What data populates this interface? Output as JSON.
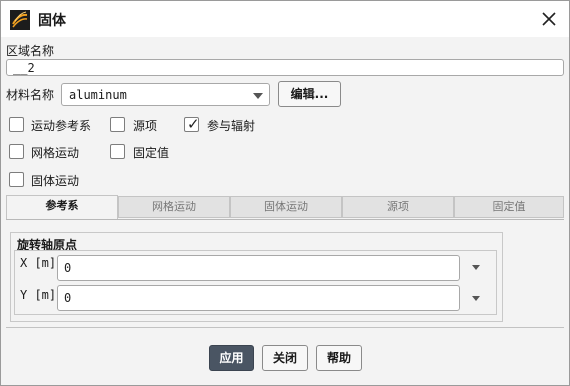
{
  "window": {
    "title": "固体"
  },
  "zone_name": {
    "label": "区域名称",
    "value": "__2"
  },
  "material": {
    "label": "材料名称",
    "selected": "aluminum",
    "edit_button": "编辑..."
  },
  "options": {
    "moving_frame": {
      "label": "运动参考系",
      "checked": false
    },
    "source_terms": {
      "label": "源项",
      "checked": false
    },
    "participates_radiation": {
      "label": "参与辐射",
      "checked": true
    },
    "mesh_motion": {
      "label": "网格运动",
      "checked": false
    },
    "fixed_values": {
      "label": "固定值",
      "checked": false
    },
    "solid_motion": {
      "label": "固体运动",
      "checked": false
    }
  },
  "tabs": [
    {
      "label": "参考系",
      "active": true
    },
    {
      "label": "网格运动",
      "active": false
    },
    {
      "label": "固体运动",
      "active": false
    },
    {
      "label": "源项",
      "active": false
    },
    {
      "label": "固定值",
      "active": false
    }
  ],
  "rotation_origin": {
    "title": "旋转轴原点",
    "x": {
      "label": "X [m]",
      "value": "0"
    },
    "y": {
      "label": "Y [m]",
      "value": "0"
    }
  },
  "footer": {
    "apply": "应用",
    "close": "关闭",
    "help": "帮助"
  },
  "colors": {
    "primary_button": "#4a5563",
    "accent": "#f0a020"
  }
}
